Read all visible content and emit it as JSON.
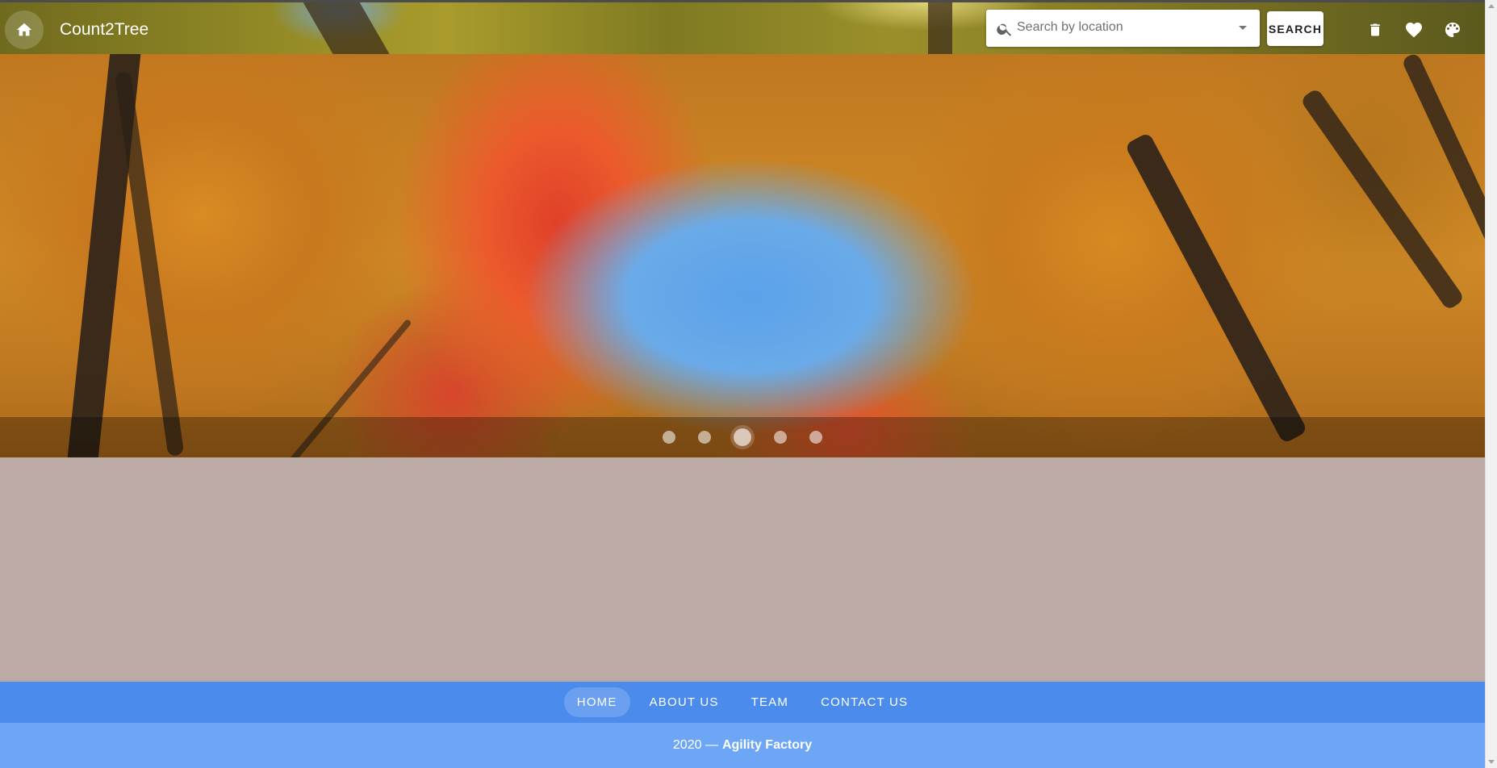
{
  "header": {
    "title": "Count2Tree",
    "search_placeholder": "Search by location",
    "search_button": "SEARCH",
    "icons": [
      "home-icon",
      "search-icon",
      "dropdown-caret-icon",
      "trash-icon",
      "heart-icon",
      "palette-icon"
    ]
  },
  "carousel": {
    "slide_count": 5,
    "active_index": 2
  },
  "footer": {
    "nav": [
      {
        "label": "HOME",
        "active": true
      },
      {
        "label": "ABOUT US",
        "active": false
      },
      {
        "label": "TEAM",
        "active": false
      },
      {
        "label": "CONTACT US",
        "active": false
      }
    ],
    "copyright_prefix": "2020 —",
    "company": "Agility Factory"
  },
  "colors": {
    "content_background": "#bcaaa4",
    "footer_nav": "#4a8bec",
    "footer_copy": "#6ea6f6"
  }
}
